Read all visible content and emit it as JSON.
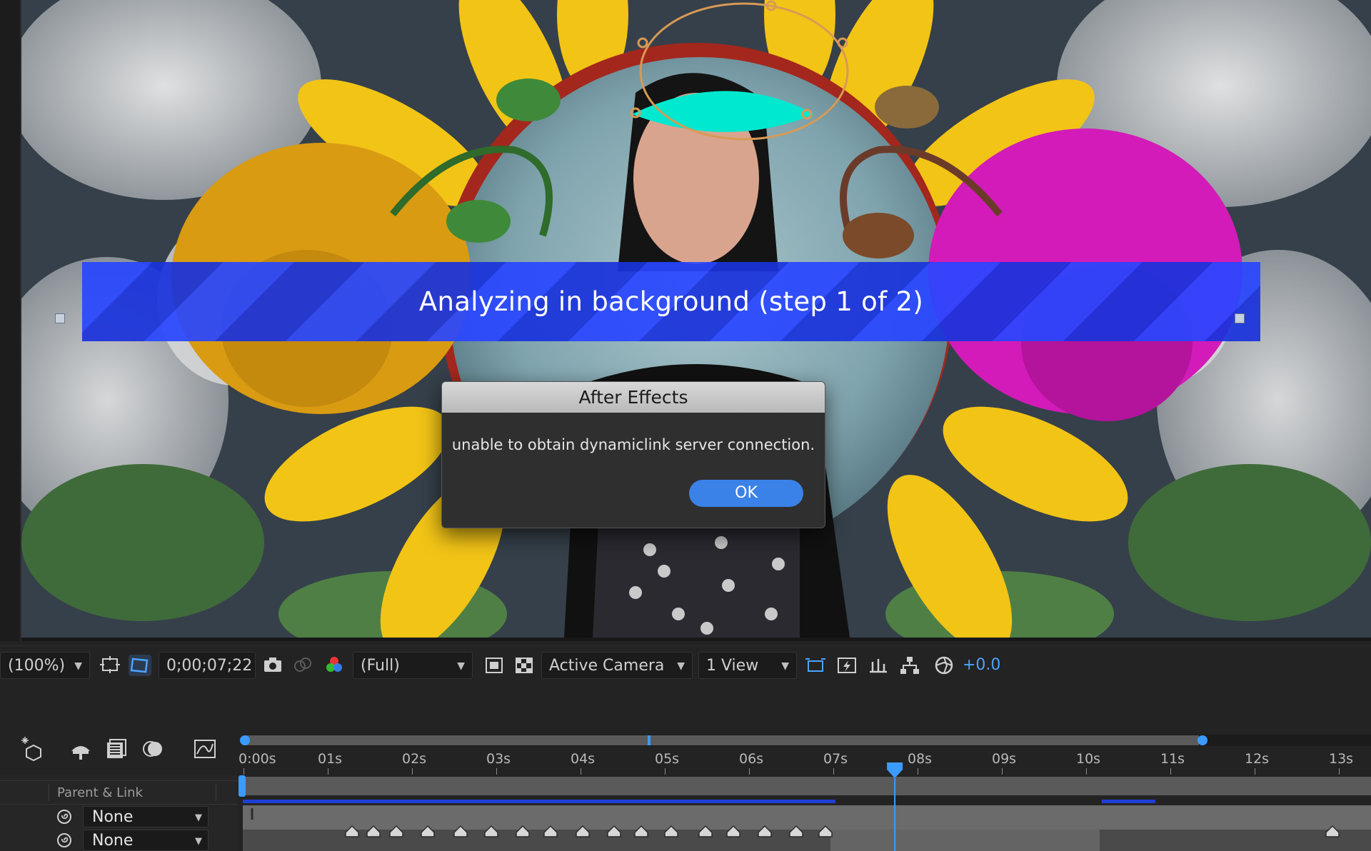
{
  "banner": {
    "text": "Analyzing in background (step 1 of 2)"
  },
  "dialog": {
    "title": "After Effects",
    "message": "unable to obtain dynamiclink server connection.",
    "ok_label": "OK"
  },
  "toolbar": {
    "magnification": "(100%)",
    "timecode": "0;00;07;22",
    "resolution": "(Full)",
    "camera": "Active Camera",
    "views": "1 View",
    "exposure": "+0.0"
  },
  "timeline": {
    "ruler_labels": [
      "0:00s",
      "01s",
      "02s",
      "03s",
      "04s",
      "05s",
      "06s",
      "07s",
      "08s",
      "09s",
      "10s",
      "11s",
      "12s",
      "13s"
    ],
    "playhead_seconds": 7.73,
    "work_area_end_seconds": 11.3,
    "column_header": "Parent & Link",
    "layers": [
      {
        "parent": "None"
      },
      {
        "parent": "None"
      }
    ]
  },
  "colors": {
    "accent": "#3b82e8",
    "banner": "#2846ff",
    "panel": "#232323",
    "playhead": "#3b9bff",
    "mask_fill": "#00e8cf"
  },
  "icons": [
    "roi-icon",
    "mask-visibility-icon",
    "snapshot-icon",
    "show-snapshot-icon",
    "color-channel-icon",
    "transparency-grid-icon",
    "fast-previews-icon",
    "flowchart-icon",
    "exposure-reset-icon"
  ]
}
